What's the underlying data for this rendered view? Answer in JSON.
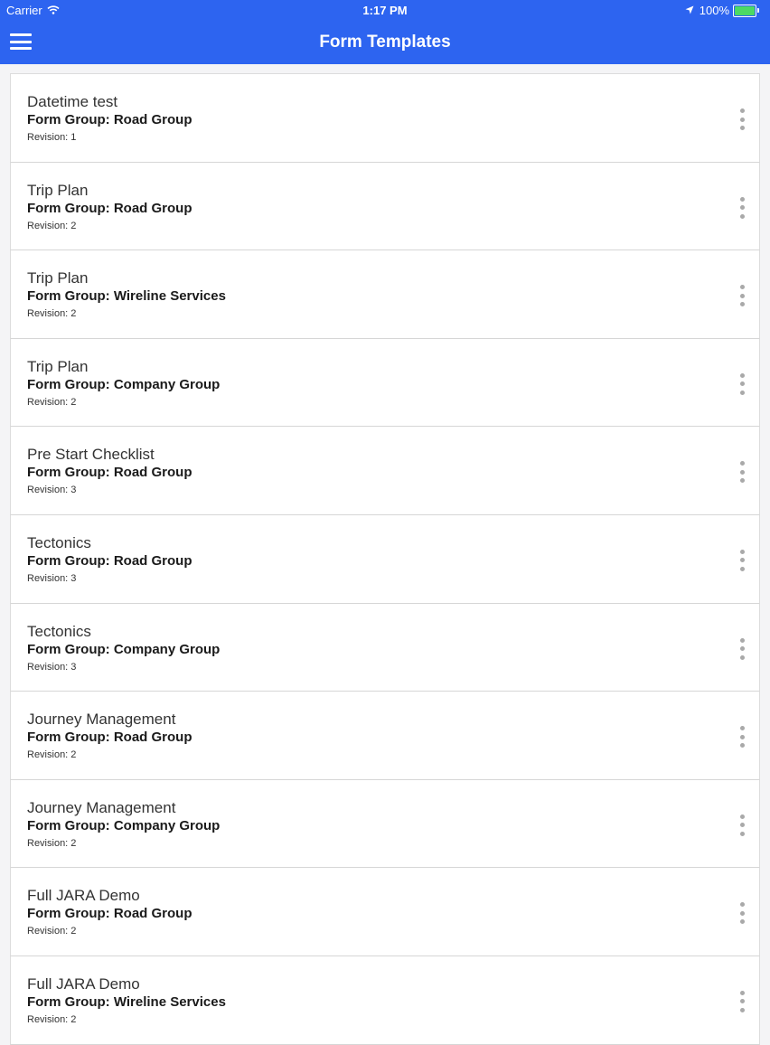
{
  "status_bar": {
    "carrier": "Carrier",
    "time": "1:17 PM",
    "battery": "100%",
    "battery_level": 1.0
  },
  "nav": {
    "title": "Form Templates"
  },
  "colors": {
    "primary": "#2d64f0",
    "battery": "#4cd964"
  },
  "templates": [
    {
      "title": "Datetime test",
      "group": "Form Group: Road Group",
      "revision": "Revision: 1"
    },
    {
      "title": "Trip Plan",
      "group": "Form Group: Road Group",
      "revision": "Revision: 2"
    },
    {
      "title": "Trip Plan",
      "group": "Form Group: Wireline Services",
      "revision": "Revision: 2"
    },
    {
      "title": "Trip Plan",
      "group": "Form Group: Company Group",
      "revision": "Revision: 2"
    },
    {
      "title": "Pre Start Checklist",
      "group": "Form Group: Road Group",
      "revision": "Revision: 3"
    },
    {
      "title": "Tectonics",
      "group": "Form Group: Road Group",
      "revision": "Revision: 3"
    },
    {
      "title": "Tectonics",
      "group": "Form Group: Company Group",
      "revision": "Revision: 3"
    },
    {
      "title": "Journey Management",
      "group": "Form Group: Road Group",
      "revision": "Revision: 2"
    },
    {
      "title": "Journey Management",
      "group": "Form Group: Company Group",
      "revision": "Revision: 2"
    },
    {
      "title": "Full JARA Demo",
      "group": "Form Group: Road Group",
      "revision": "Revision: 2"
    },
    {
      "title": "Full JARA Demo",
      "group": "Form Group: Wireline Services",
      "revision": "Revision: 2"
    }
  ]
}
